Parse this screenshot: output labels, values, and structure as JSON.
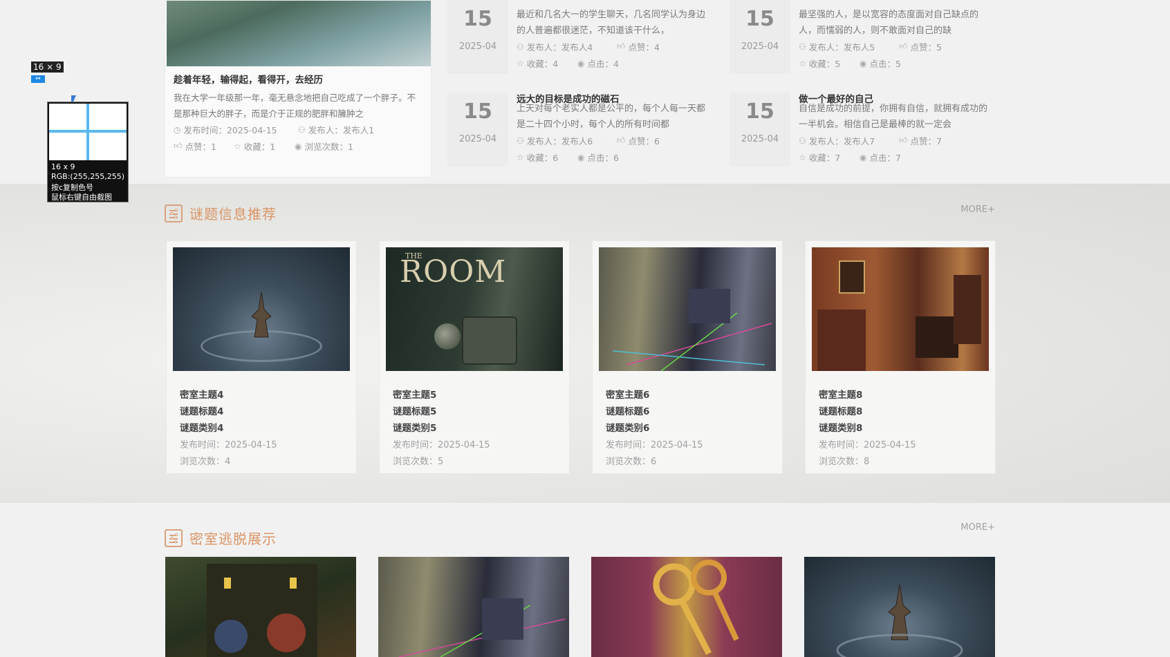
{
  "featured": {
    "title": "趁着年轻，输得起，看得开，去经历",
    "desc": "我在大学一年级那一年，毫无悬念地把自己吃成了一个胖子。不是那种巨大的胖子，而是介于正规的肥胖和臃肿之",
    "publish_time": "发布时间：2025-04-15",
    "publisher": "发布人：发布人1",
    "likes": "点赞：1",
    "favorites": "收藏：1",
    "views": "浏览次数：1"
  },
  "news": [
    {
      "day": "15",
      "ym": "2025-04",
      "title": "",
      "desc": "最近和几名大一的学生聊天，几名同学认为身边的人普遍都很迷茫，不知道该干什么，",
      "publisher": "发布人：发布人4",
      "likes": "点赞：4",
      "favorites": "收藏：4",
      "clicks": "点击：4"
    },
    {
      "day": "15",
      "ym": "2025-04",
      "title": "",
      "desc": "最坚强的人，是以宽容的态度面对自己缺点的人，而懦弱的人，则不敢面对自己的缺",
      "publisher": "发布人：发布人5",
      "likes": "点赞：5",
      "favorites": "收藏：5",
      "clicks": "点击：5"
    },
    {
      "day": "15",
      "ym": "2025-04",
      "title": "远大的目标是成功的磁石",
      "desc": "上天对每个老实人都是公平的，每个人每一天都是二十四个小时，每个人的所有时间都",
      "publisher": "发布人：发布人6",
      "likes": "点赞：6",
      "favorites": "收藏：6",
      "clicks": "点击：6"
    },
    {
      "day": "15",
      "ym": "2025-04",
      "title": "做一个最好的自己",
      "desc": "自信是成功的前提，你拥有自信，就拥有成功的一半机会。相信自己是最棒的就一定会",
      "publisher": "发布人：发布人7",
      "likes": "点赞：7",
      "favorites": "收藏：7",
      "clicks": "点击：7"
    }
  ],
  "section_puzzle": {
    "title": "谜题信息推荐",
    "more": "MORE+",
    "cards": [
      {
        "theme": "密室主题4",
        "puzzle_title": "谜题标题4",
        "category": "谜题类别4",
        "publish_time": "发布时间：2025-04-15",
        "views": "浏览次数：4"
      },
      {
        "theme": "密室主题5",
        "puzzle_title": "谜题标题5",
        "category": "谜题类别5",
        "publish_time": "发布时间：2025-04-15",
        "views": "浏览次数：5",
        "image_text": "ROOM",
        "image_text_small": "THE"
      },
      {
        "theme": "密室主题6",
        "puzzle_title": "谜题标题6",
        "category": "谜题类别6",
        "publish_time": "发布时间：2025-04-15",
        "views": "浏览次数：6"
      },
      {
        "theme": "密室主题8",
        "puzzle_title": "谜题标题8",
        "category": "谜题类别8",
        "publish_time": "发布时间：2025-04-15",
        "views": "浏览次数：8"
      }
    ]
  },
  "section_showcase": {
    "title": "密室逃脱展示",
    "more": "MORE+"
  },
  "picker": {
    "size_label": "16 × 9",
    "size": "16 x 9",
    "rgb": "RGB:(255,255,255)",
    "hint_copy": "按c复制色号",
    "hint_capture": "鼠标右键自由截图"
  },
  "colors": {
    "accent": "#d99566",
    "crosshair": "#5bb8f0"
  }
}
